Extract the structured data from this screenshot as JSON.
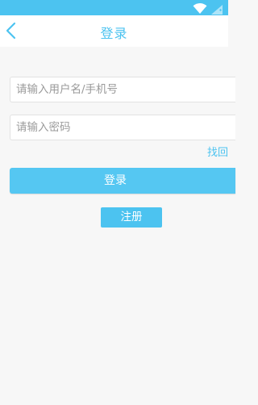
{
  "colors": {
    "accent": "#4cc3f0",
    "background": "#f7f7f7"
  },
  "status_bar": {
    "icons": [
      "wifi-icon",
      "signal-icon"
    ]
  },
  "nav": {
    "back_icon": "chevron-left-icon",
    "title": "登录"
  },
  "form": {
    "username_placeholder": "请输入用户名/手机号",
    "password_placeholder": "请输入密码",
    "forgot_label": "找回"
  },
  "actions": {
    "login_label": "登录",
    "register_label": "注册"
  }
}
